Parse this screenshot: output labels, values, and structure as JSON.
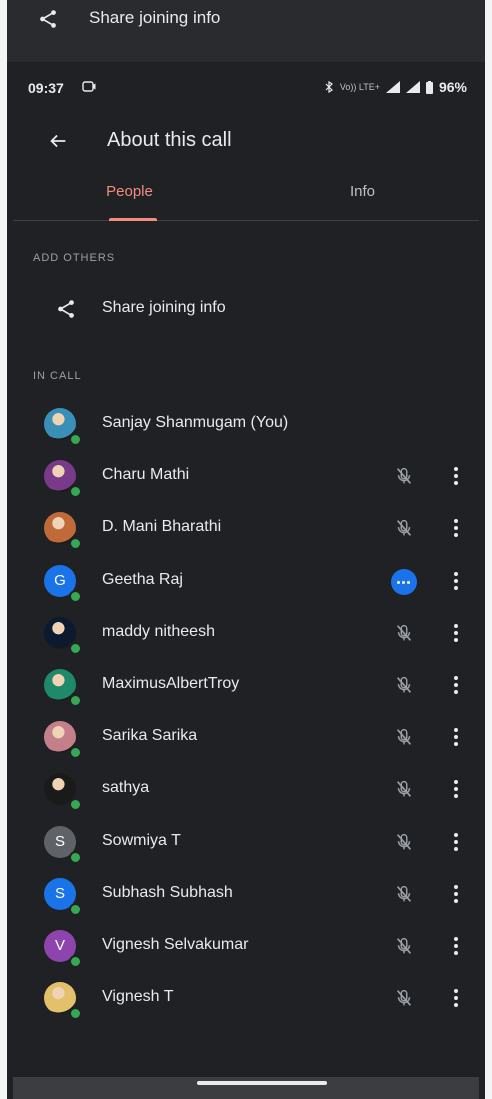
{
  "ghost_header": {
    "label": "Share joining info"
  },
  "status_bar": {
    "time": "09:37",
    "network": "Vo)) LTE+",
    "battery": "96%"
  },
  "app_bar": {
    "title": "About this call"
  },
  "tabs": [
    {
      "label": "People",
      "active": true
    },
    {
      "label": "Info",
      "active": false
    }
  ],
  "add_others": {
    "section_label": "ADD OTHERS",
    "share_label": "Share joining info"
  },
  "in_call": {
    "section_label": "IN CALL",
    "participants": [
      {
        "name": "Sanjay Shanmugam (You)",
        "avatar": "photo",
        "initial": "",
        "color": "#3a8fb7",
        "status": "self"
      },
      {
        "name": "Charu Mathi",
        "avatar": "photo",
        "initial": "",
        "color": "#7a3a8a",
        "status": "muted"
      },
      {
        "name": "D. Mani Bharathi",
        "avatar": "photo",
        "initial": "",
        "color": "#c06a3a",
        "status": "muted"
      },
      {
        "name": "Geetha Raj",
        "avatar": "initial",
        "initial": "G",
        "color": "#1a73e8",
        "status": "speaking"
      },
      {
        "name": "maddy nitheesh",
        "avatar": "photo",
        "initial": "",
        "color": "#0b1a2e",
        "status": "muted"
      },
      {
        "name": "MaximusAlbertTroy",
        "avatar": "photo",
        "initial": "",
        "color": "#1f8a6a",
        "status": "muted"
      },
      {
        "name": "Sarika Sarika",
        "avatar": "photo",
        "initial": "",
        "color": "#c57f8a",
        "status": "muted"
      },
      {
        "name": "sathya",
        "avatar": "photo",
        "initial": "",
        "color": "#1a1a1a",
        "status": "muted"
      },
      {
        "name": "Sowmiya T",
        "avatar": "initial",
        "initial": "S",
        "color": "#5f6368",
        "status": "muted"
      },
      {
        "name": "Subhash Subhash",
        "avatar": "initial",
        "initial": "S",
        "color": "#1a73e8",
        "status": "muted"
      },
      {
        "name": "Vignesh Selvakumar",
        "avatar": "initial",
        "initial": "V",
        "color": "#8e44ad",
        "status": "muted"
      },
      {
        "name": "Vignesh T",
        "avatar": "photo",
        "initial": "",
        "color": "#e3c06a",
        "status": "muted"
      }
    ]
  },
  "icons": {
    "share": "share-icon",
    "back": "back-arrow-icon",
    "mute": "mic-off-icon",
    "more": "more-vert-icon",
    "speaking": "speaking-indicator-icon"
  }
}
